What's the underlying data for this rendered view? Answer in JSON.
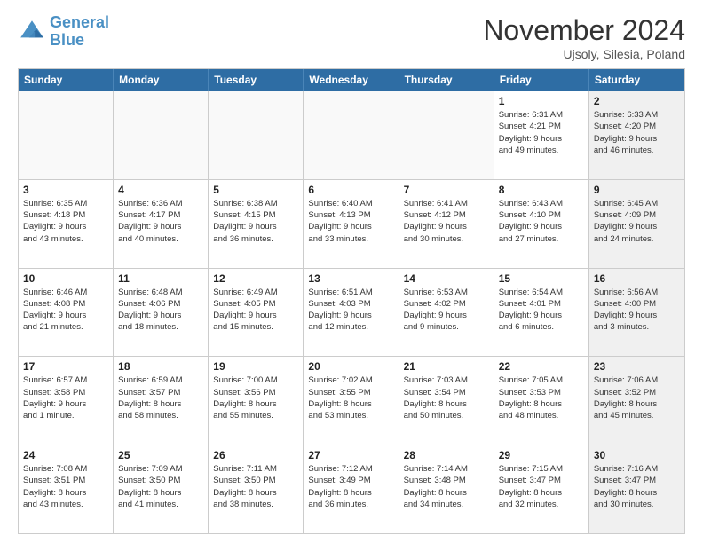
{
  "header": {
    "logo_line1": "General",
    "logo_line2": "Blue",
    "month_title": "November 2024",
    "subtitle": "Ujsoly, Silesia, Poland"
  },
  "weekdays": [
    "Sunday",
    "Monday",
    "Tuesday",
    "Wednesday",
    "Thursday",
    "Friday",
    "Saturday"
  ],
  "rows": [
    [
      {
        "day": "",
        "info": "",
        "shaded": false,
        "empty": true
      },
      {
        "day": "",
        "info": "",
        "shaded": false,
        "empty": true
      },
      {
        "day": "",
        "info": "",
        "shaded": false,
        "empty": true
      },
      {
        "day": "",
        "info": "",
        "shaded": false,
        "empty": true
      },
      {
        "day": "",
        "info": "",
        "shaded": false,
        "empty": true
      },
      {
        "day": "1",
        "info": "Sunrise: 6:31 AM\nSunset: 4:21 PM\nDaylight: 9 hours\nand 49 minutes.",
        "shaded": false,
        "empty": false
      },
      {
        "day": "2",
        "info": "Sunrise: 6:33 AM\nSunset: 4:20 PM\nDaylight: 9 hours\nand 46 minutes.",
        "shaded": true,
        "empty": false
      }
    ],
    [
      {
        "day": "3",
        "info": "Sunrise: 6:35 AM\nSunset: 4:18 PM\nDaylight: 9 hours\nand 43 minutes.",
        "shaded": false,
        "empty": false
      },
      {
        "day": "4",
        "info": "Sunrise: 6:36 AM\nSunset: 4:17 PM\nDaylight: 9 hours\nand 40 minutes.",
        "shaded": false,
        "empty": false
      },
      {
        "day": "5",
        "info": "Sunrise: 6:38 AM\nSunset: 4:15 PM\nDaylight: 9 hours\nand 36 minutes.",
        "shaded": false,
        "empty": false
      },
      {
        "day": "6",
        "info": "Sunrise: 6:40 AM\nSunset: 4:13 PM\nDaylight: 9 hours\nand 33 minutes.",
        "shaded": false,
        "empty": false
      },
      {
        "day": "7",
        "info": "Sunrise: 6:41 AM\nSunset: 4:12 PM\nDaylight: 9 hours\nand 30 minutes.",
        "shaded": false,
        "empty": false
      },
      {
        "day": "8",
        "info": "Sunrise: 6:43 AM\nSunset: 4:10 PM\nDaylight: 9 hours\nand 27 minutes.",
        "shaded": false,
        "empty": false
      },
      {
        "day": "9",
        "info": "Sunrise: 6:45 AM\nSunset: 4:09 PM\nDaylight: 9 hours\nand 24 minutes.",
        "shaded": true,
        "empty": false
      }
    ],
    [
      {
        "day": "10",
        "info": "Sunrise: 6:46 AM\nSunset: 4:08 PM\nDaylight: 9 hours\nand 21 minutes.",
        "shaded": false,
        "empty": false
      },
      {
        "day": "11",
        "info": "Sunrise: 6:48 AM\nSunset: 4:06 PM\nDaylight: 9 hours\nand 18 minutes.",
        "shaded": false,
        "empty": false
      },
      {
        "day": "12",
        "info": "Sunrise: 6:49 AM\nSunset: 4:05 PM\nDaylight: 9 hours\nand 15 minutes.",
        "shaded": false,
        "empty": false
      },
      {
        "day": "13",
        "info": "Sunrise: 6:51 AM\nSunset: 4:03 PM\nDaylight: 9 hours\nand 12 minutes.",
        "shaded": false,
        "empty": false
      },
      {
        "day": "14",
        "info": "Sunrise: 6:53 AM\nSunset: 4:02 PM\nDaylight: 9 hours\nand 9 minutes.",
        "shaded": false,
        "empty": false
      },
      {
        "day": "15",
        "info": "Sunrise: 6:54 AM\nSunset: 4:01 PM\nDaylight: 9 hours\nand 6 minutes.",
        "shaded": false,
        "empty": false
      },
      {
        "day": "16",
        "info": "Sunrise: 6:56 AM\nSunset: 4:00 PM\nDaylight: 9 hours\nand 3 minutes.",
        "shaded": true,
        "empty": false
      }
    ],
    [
      {
        "day": "17",
        "info": "Sunrise: 6:57 AM\nSunset: 3:58 PM\nDaylight: 9 hours\nand 1 minute.",
        "shaded": false,
        "empty": false
      },
      {
        "day": "18",
        "info": "Sunrise: 6:59 AM\nSunset: 3:57 PM\nDaylight: 8 hours\nand 58 minutes.",
        "shaded": false,
        "empty": false
      },
      {
        "day": "19",
        "info": "Sunrise: 7:00 AM\nSunset: 3:56 PM\nDaylight: 8 hours\nand 55 minutes.",
        "shaded": false,
        "empty": false
      },
      {
        "day": "20",
        "info": "Sunrise: 7:02 AM\nSunset: 3:55 PM\nDaylight: 8 hours\nand 53 minutes.",
        "shaded": false,
        "empty": false
      },
      {
        "day": "21",
        "info": "Sunrise: 7:03 AM\nSunset: 3:54 PM\nDaylight: 8 hours\nand 50 minutes.",
        "shaded": false,
        "empty": false
      },
      {
        "day": "22",
        "info": "Sunrise: 7:05 AM\nSunset: 3:53 PM\nDaylight: 8 hours\nand 48 minutes.",
        "shaded": false,
        "empty": false
      },
      {
        "day": "23",
        "info": "Sunrise: 7:06 AM\nSunset: 3:52 PM\nDaylight: 8 hours\nand 45 minutes.",
        "shaded": true,
        "empty": false
      }
    ],
    [
      {
        "day": "24",
        "info": "Sunrise: 7:08 AM\nSunset: 3:51 PM\nDaylight: 8 hours\nand 43 minutes.",
        "shaded": false,
        "empty": false
      },
      {
        "day": "25",
        "info": "Sunrise: 7:09 AM\nSunset: 3:50 PM\nDaylight: 8 hours\nand 41 minutes.",
        "shaded": false,
        "empty": false
      },
      {
        "day": "26",
        "info": "Sunrise: 7:11 AM\nSunset: 3:50 PM\nDaylight: 8 hours\nand 38 minutes.",
        "shaded": false,
        "empty": false
      },
      {
        "day": "27",
        "info": "Sunrise: 7:12 AM\nSunset: 3:49 PM\nDaylight: 8 hours\nand 36 minutes.",
        "shaded": false,
        "empty": false
      },
      {
        "day": "28",
        "info": "Sunrise: 7:14 AM\nSunset: 3:48 PM\nDaylight: 8 hours\nand 34 minutes.",
        "shaded": false,
        "empty": false
      },
      {
        "day": "29",
        "info": "Sunrise: 7:15 AM\nSunset: 3:47 PM\nDaylight: 8 hours\nand 32 minutes.",
        "shaded": false,
        "empty": false
      },
      {
        "day": "30",
        "info": "Sunrise: 7:16 AM\nSunset: 3:47 PM\nDaylight: 8 hours\nand 30 minutes.",
        "shaded": true,
        "empty": false
      }
    ]
  ]
}
